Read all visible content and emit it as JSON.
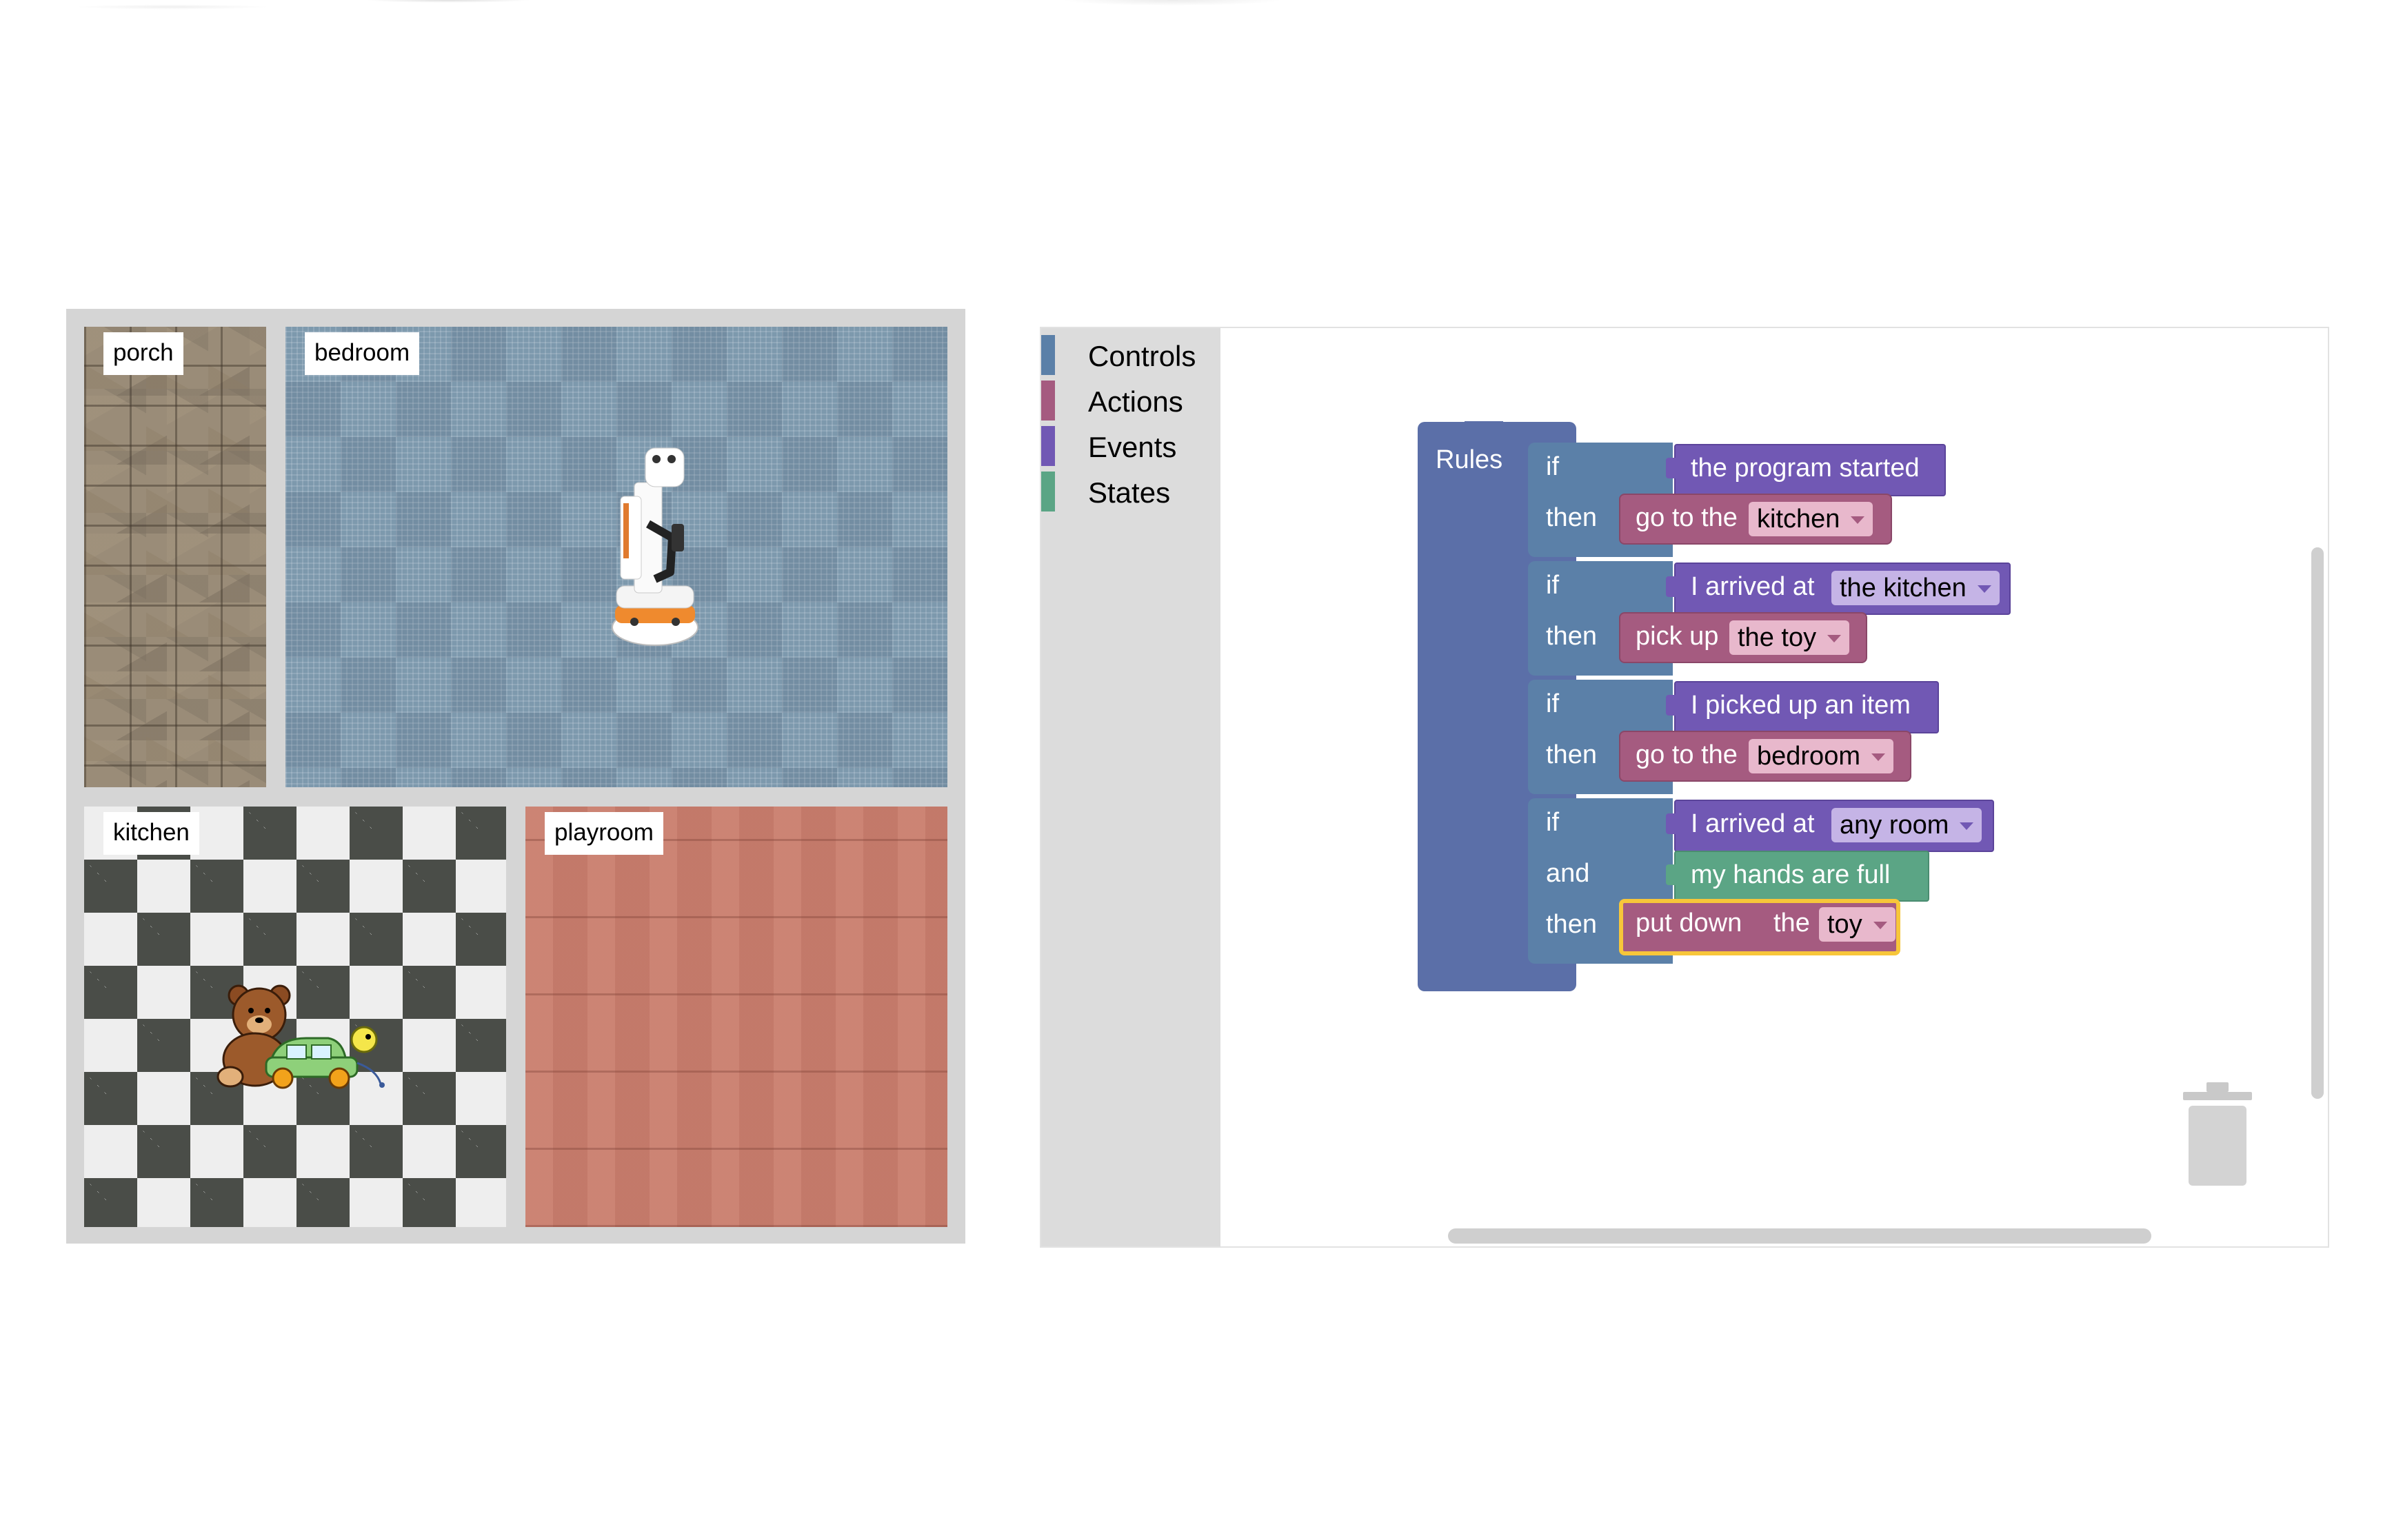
{
  "map": {
    "rooms": {
      "porch": "porch",
      "bedroom": "bedroom",
      "kitchen": "kitchen",
      "playroom": "playroom"
    }
  },
  "toolbox": {
    "categories": [
      {
        "label": "Controls",
        "color": "#5b80a8"
      },
      {
        "label": "Actions",
        "color": "#a55b80"
      },
      {
        "label": "Events",
        "color": "#7158b4"
      },
      {
        "label": "States",
        "color": "#5ba585"
      }
    ]
  },
  "program": {
    "container_label": "Rules",
    "rules": [
      {
        "if_kw": "if",
        "then_kw": "then",
        "event_text": "the program started",
        "action_text": "go to the",
        "action_option": "kitchen"
      },
      {
        "if_kw": "if",
        "then_kw": "then",
        "event_text": "I arrived at",
        "event_option": "the kitchen",
        "action_text": "pick up",
        "action_option": "the toy"
      },
      {
        "if_kw": "if",
        "then_kw": "then",
        "event_text": "I picked up an item",
        "action_text": "go to the",
        "action_option": "bedroom"
      },
      {
        "if_kw": "if",
        "and_kw": "and",
        "then_kw": "then",
        "event_text": "I arrived at",
        "event_option": "any room",
        "state_text": "my hands are full",
        "action_text": "put down",
        "action_text2": "the",
        "action_option": "toy"
      }
    ]
  },
  "colors": {
    "controls": "#5b6fa8",
    "actions": "#a55b80",
    "events": "#7158b4",
    "states": "#5ba585",
    "selected_outline": "#f7c63a"
  },
  "icons": {
    "robot": "robot-icon",
    "toys": "toys-icon",
    "trash": "trash-icon",
    "dropdown": "chevron-down-icon"
  }
}
